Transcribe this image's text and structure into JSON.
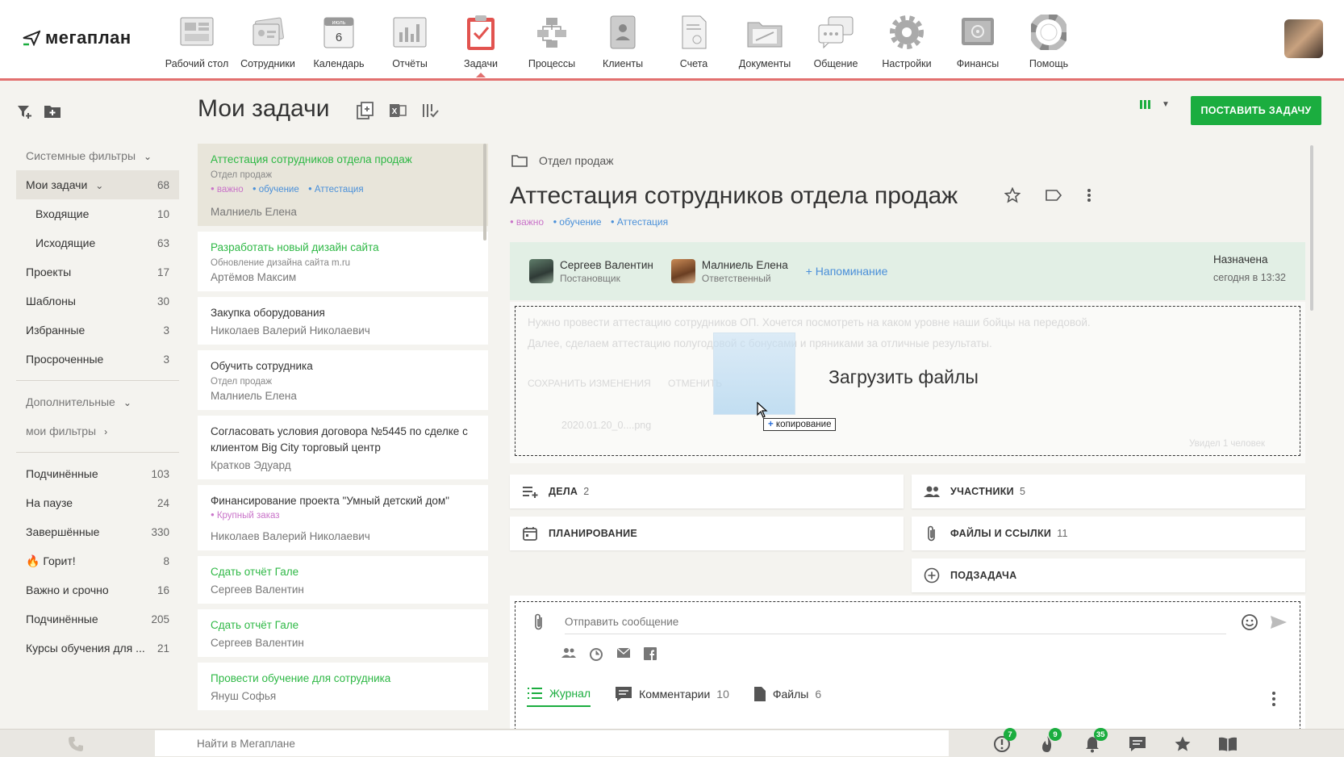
{
  "app": {
    "logo_text": "мегаплан"
  },
  "nav": [
    {
      "label": "Рабочий стол",
      "icon": "desktop-icon"
    },
    {
      "label": "Сотрудники",
      "icon": "employees-icon"
    },
    {
      "label": "Календарь",
      "icon": "calendar-icon",
      "calendar_month": "июль",
      "calendar_day": "6"
    },
    {
      "label": "Отчёты",
      "icon": "reports-icon"
    },
    {
      "label": "Задачи",
      "icon": "tasks-icon",
      "active": true
    },
    {
      "label": "Процессы",
      "icon": "processes-icon"
    },
    {
      "label": "Клиенты",
      "icon": "clients-icon"
    },
    {
      "label": "Счета",
      "icon": "invoices-icon"
    },
    {
      "label": "Документы",
      "icon": "documents-icon"
    },
    {
      "label": "Общение",
      "icon": "chat-icon"
    },
    {
      "label": "Настройки",
      "icon": "settings-icon"
    },
    {
      "label": "Финансы",
      "icon": "finance-icon"
    },
    {
      "label": "Помощь",
      "icon": "help-icon"
    }
  ],
  "sidebar": {
    "system_filters": "Системные фильтры",
    "items": [
      {
        "label": "Мои задачи",
        "count": "68"
      },
      {
        "label": "Входящие",
        "count": "10"
      },
      {
        "label": "Исходящие",
        "count": "63"
      },
      {
        "label": "Проекты",
        "count": "17"
      },
      {
        "label": "Шаблоны",
        "count": "30"
      },
      {
        "label": "Избранные",
        "count": "3"
      },
      {
        "label": "Просроченные",
        "count": "3"
      }
    ],
    "additional": "Дополнительные",
    "my_filters": "мои фильтры",
    "custom": [
      {
        "label": "Подчинённые",
        "count": "103"
      },
      {
        "label": "На паузе",
        "count": "24"
      },
      {
        "label": "Завершённые",
        "count": "330"
      },
      {
        "label": "🔥 Горит!",
        "count": "8"
      },
      {
        "label": "Важно и срочно",
        "count": "16"
      },
      {
        "label": "Подчинённые",
        "count": "205"
      },
      {
        "label": "Курсы обучения для ...",
        "count": "21"
      }
    ]
  },
  "list": {
    "title": "Мои задачи",
    "tasks": [
      {
        "title": "Аттестация сотрудников отдела продаж",
        "sub": "Отдел продаж",
        "tags": [
          "важно",
          "обучение",
          "Аттестация"
        ],
        "person": "Малниель Елена"
      },
      {
        "title": "Разработать новый дизайн сайта",
        "sub": "Обновление дизайна сайта m.ru",
        "person": "Артёмов Максим"
      },
      {
        "title": "Закупка оборудования",
        "person": "Николаев Валерий Николаевич"
      },
      {
        "title": "Обучить сотрудника",
        "sub": "Отдел продаж",
        "person": "Малниель Елена"
      },
      {
        "title": "Согласовать условия договора №5445 по сделке с клиентом Big City торговый центр",
        "person": "Кратков Эдуард"
      },
      {
        "title": "Финансирование проекта \"Умный детский дом\"",
        "tags": [
          "Крупный заказ"
        ],
        "person": "Николаев Валерий Николаевич"
      },
      {
        "title": "Сдать отчёт Гале",
        "person": "Сергеев Валентин"
      },
      {
        "title": "Сдать отчёт Гале",
        "person": "Сергеев Валентин"
      },
      {
        "title": "Провести обучение для сотрудника",
        "person": "Януш Софья"
      }
    ]
  },
  "detail": {
    "create_button": "ПОСТАВИТЬ ЗАДАЧУ",
    "breadcrumb": "Отдел продаж",
    "title": "Аттестация сотрудников отдела продаж",
    "tags": [
      "важно",
      "обучение",
      "Аттестация"
    ],
    "author": {
      "name": "Сергеев Валентин",
      "role": "Постановщик"
    },
    "responsible": {
      "name": "Малниель Елена",
      "role": "Ответственный"
    },
    "reminder": "+ Напоминание",
    "status": "Назначена",
    "status_time": "сегодня в 13:32",
    "desc_line1": "Нужно провести аттестацию сотрудников ОП. Хочется посмотреть на каком уровне наши бойцы на передовой.",
    "desc_line2": "Далее, сделаем аттестацию полугодовой с бонусами и пряниками за отличные результаты.",
    "save_changes": "СОХРАНИТЬ ИЗМЕНЕНИЯ",
    "cancel": "ОТМЕНИТЬ",
    "attachment": "2020.01.20_0....png",
    "seen": "Увидел 1 человек",
    "upload_files": "Загрузить файлы",
    "copy_label": "копирование",
    "cards": {
      "deals": "ДЕЛА",
      "deals_count": "2",
      "participants": "УЧАСТНИКИ",
      "participants_count": "5",
      "planning": "ПЛАНИРОВАНИЕ",
      "files_links": "ФАЙЛЫ И ССЫЛКИ",
      "files_links_count": "11",
      "subtask": "ПОДЗАДАЧА"
    },
    "composer": {
      "placeholder": "Отправить сообщение"
    },
    "tabs": [
      {
        "label": "Журнал",
        "count": ""
      },
      {
        "label": "Комментарии",
        "count": "10"
      },
      {
        "label": "Файлы",
        "count": "6"
      }
    ]
  },
  "bottom": {
    "search_placeholder": "Найти в Мегаплане",
    "badges": {
      "alerts": "7",
      "hot": "9",
      "notifications": "35"
    }
  },
  "colors": {
    "accent": "#1bad3f",
    "nav_underline": "#e2706f",
    "tag_pink": "#c973c9",
    "tag_blue": "#4a90d9"
  }
}
